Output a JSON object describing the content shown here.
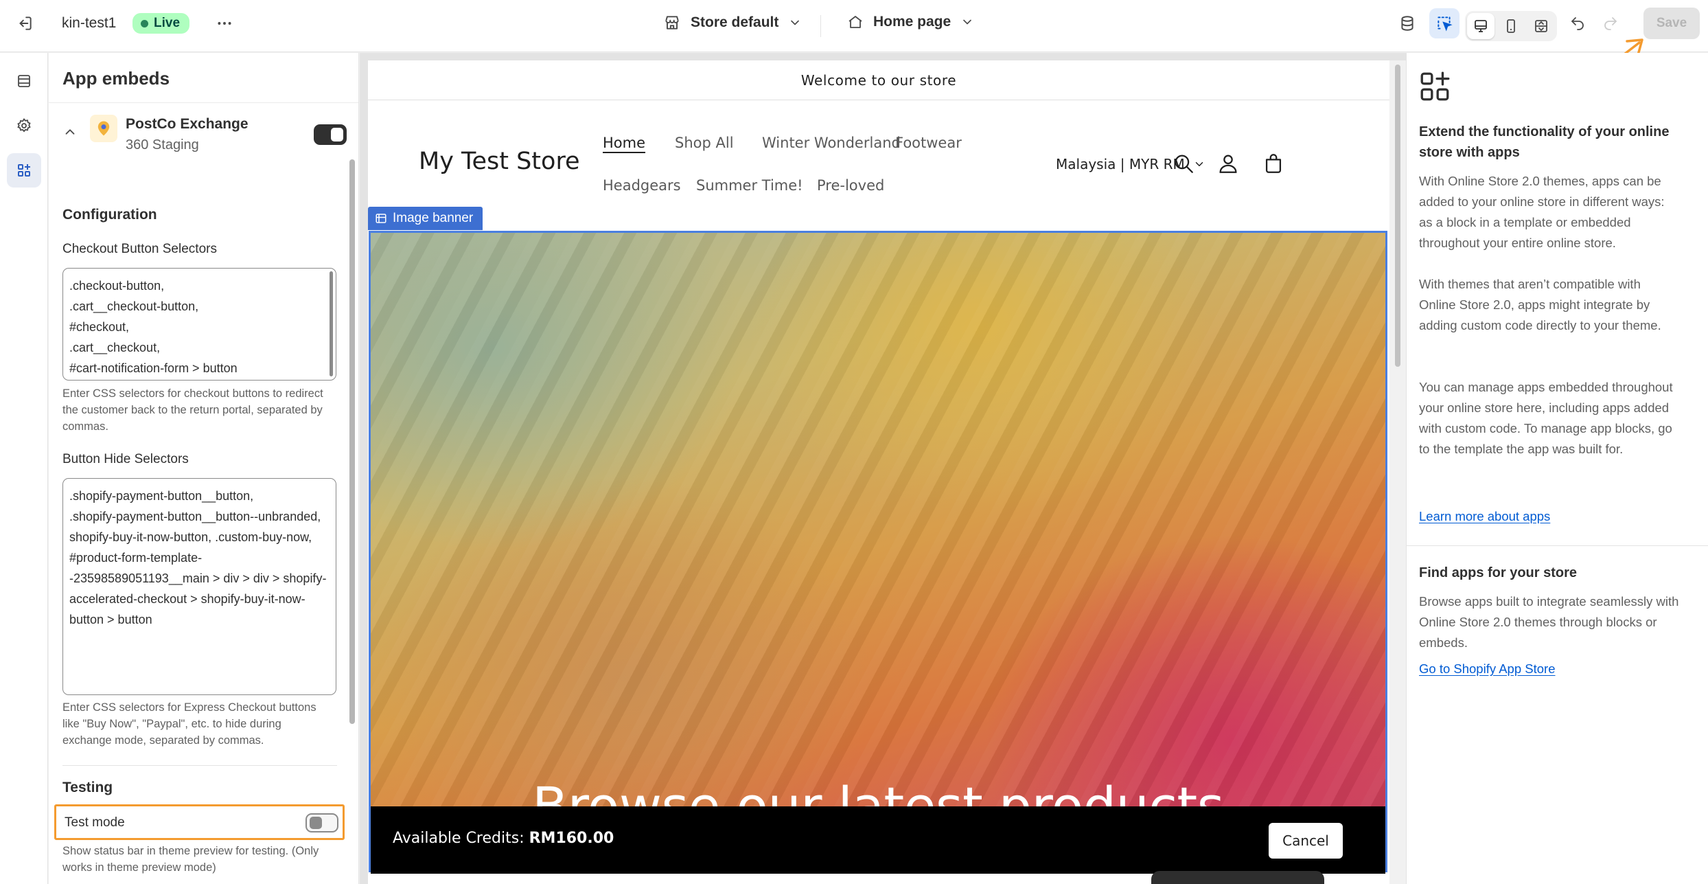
{
  "topbar": {
    "store_name": "kin-test1",
    "status_badge": "Live",
    "theme_selector": "Store default",
    "page_selector": "Home page",
    "save_label": "Save"
  },
  "panel": {
    "title": "App embeds",
    "app": {
      "name": "PostCo Exchange",
      "subtitle": "360 Staging",
      "enabled": true
    },
    "configuration_heading": "Configuration",
    "checkout_label": "Checkout Button Selectors",
    "checkout_value": ".checkout-button,\n.cart__checkout-button,\n#checkout,\n.cart__checkout,\n#cart-notification-form > button",
    "checkout_help": "Enter CSS selectors for checkout buttons to redirect the customer back to the return portal, separated by commas.",
    "hide_label": "Button Hide Selectors",
    "hide_value": ".shopify-payment-button__button,\n.shopify-payment-button__button--unbranded,\nshopify-buy-it-now-button, .custom-buy-now, #product-form-template--23598589051193__main > div > div > shopify-accelerated-checkout > shopify-buy-it-now-button > button",
    "hide_help": "Enter CSS selectors for Express Checkout buttons like \"Buy Now\", \"Paypal\", etc. to hide during exchange mode, separated by commas.",
    "testing_heading": "Testing",
    "test_mode_label": "Test mode",
    "test_mode_enabled": false,
    "test_mode_help": "Show status bar in theme preview for testing. (Only works in theme preview mode)"
  },
  "preview": {
    "announcement": "Welcome to our store",
    "store_logo": "My Test Store",
    "nav": [
      "Home",
      "Shop All",
      "Winter Wonderland",
      "Footwear",
      "Headgears",
      "Summer Time!",
      "Pre-loved"
    ],
    "locale": "Malaysia | MYR RM",
    "section_tag": "Image banner",
    "banner_heading": "Browse our latest products",
    "credits_label": "Available Credits:",
    "credits_value": "RM160.00",
    "cancel_label": "Cancel"
  },
  "info": {
    "heading": "Extend the functionality of your online store with apps",
    "p1": "With Online Store 2.0 themes, apps can be added to your online store in different ways: as a block in a template or embedded throughout your entire online store.",
    "p2": "With themes that aren’t compatible with Online Store 2.0, apps might integrate by adding custom code directly to your theme.",
    "p3": "You can manage apps embedded throughout your online store here, including apps added with custom code. To manage app blocks, go to the template the app was built for.",
    "learn_link": "Learn more about apps",
    "find_heading": "Find apps for your store",
    "find_p": "Browse apps built to integrate seamlessly with Online Store 2.0 themes through blocks or embeds.",
    "store_link": "Go to Shopify App Store"
  },
  "colors": {
    "accent_orange": "#f49b2f",
    "selection_blue": "#3d6fd1",
    "link_blue": "#005bd3",
    "live_green": "#29845a"
  },
  "icons": [
    "exit-icon",
    "more-icon",
    "store-icon",
    "home-icon",
    "chevron-down-icon",
    "database-icon",
    "inspector-icon",
    "desktop-icon",
    "mobile-icon",
    "fullscreen-icon",
    "undo-icon",
    "redo-icon",
    "sections-icon",
    "settings-icon",
    "app-embeds-icon",
    "app-add-icon",
    "search-icon",
    "account-icon",
    "cart-icon"
  ]
}
